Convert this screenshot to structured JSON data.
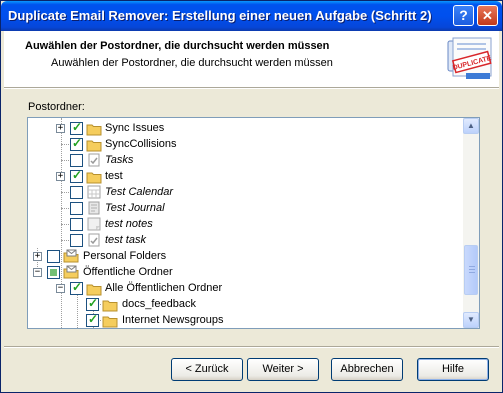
{
  "window": {
    "title": "Duplicate Email Remover: Erstellung einer neuen Aufgabe (Schritt 2)",
    "help_button": "?",
    "close_button": "✕"
  },
  "header": {
    "title": "Auwählen der Postordner, die durchsucht werden müssen",
    "subtitle": "Auwählen der Postordner, die durchsucht werden müssen",
    "logo_text": "DUPLICATE"
  },
  "tree": {
    "label": "Postordner:",
    "items": [
      {
        "label": "Sync Issues",
        "icon": "folder-icon",
        "checked": true,
        "expander": "+",
        "italic": false
      },
      {
        "label": "SyncCollisions",
        "icon": "folder-icon",
        "checked": true,
        "expander": "",
        "italic": false
      },
      {
        "label": "Tasks",
        "icon": "tasks-icon",
        "checked": false,
        "expander": "",
        "italic": true
      },
      {
        "label": "test",
        "icon": "folder-icon",
        "checked": true,
        "expander": "+",
        "italic": false
      },
      {
        "label": "Test Calendar",
        "icon": "calendar-icon",
        "checked": false,
        "expander": "",
        "italic": true
      },
      {
        "label": "Test Journal",
        "icon": "journal-icon",
        "checked": false,
        "expander": "",
        "italic": true
      },
      {
        "label": "test notes",
        "icon": "notes-icon",
        "checked": false,
        "expander": "",
        "italic": true
      },
      {
        "label": "test task",
        "icon": "tasks-icon",
        "checked": false,
        "expander": "",
        "italic": true
      },
      {
        "label": "Personal Folders",
        "icon": "mailbox-icon",
        "checked": false,
        "expander": "+",
        "italic": false
      },
      {
        "label": "Öffentliche Ordner",
        "icon": "mailbox-icon",
        "checked": "partial",
        "expander": "−",
        "italic": false
      },
      {
        "label": "Alle Öffentlichen Ordner",
        "icon": "folder-icon",
        "checked": true,
        "expander": "−",
        "italic": false
      },
      {
        "label": "docs_feedback",
        "icon": "folder-icon",
        "checked": true,
        "expander": "",
        "italic": false
      },
      {
        "label": "Internet Newsgroups",
        "icon": "folder-icon",
        "checked": true,
        "expander": "",
        "italic": false
      }
    ]
  },
  "buttons": {
    "back": "< Zurück",
    "next": "Weiter >",
    "cancel": "Abbrechen",
    "help": "Hilfe"
  },
  "colors": {
    "title_bar": "#0050ee",
    "dialog_bg": "#ece9d8",
    "folder": "#f5cd5d",
    "check": "#21a121"
  }
}
